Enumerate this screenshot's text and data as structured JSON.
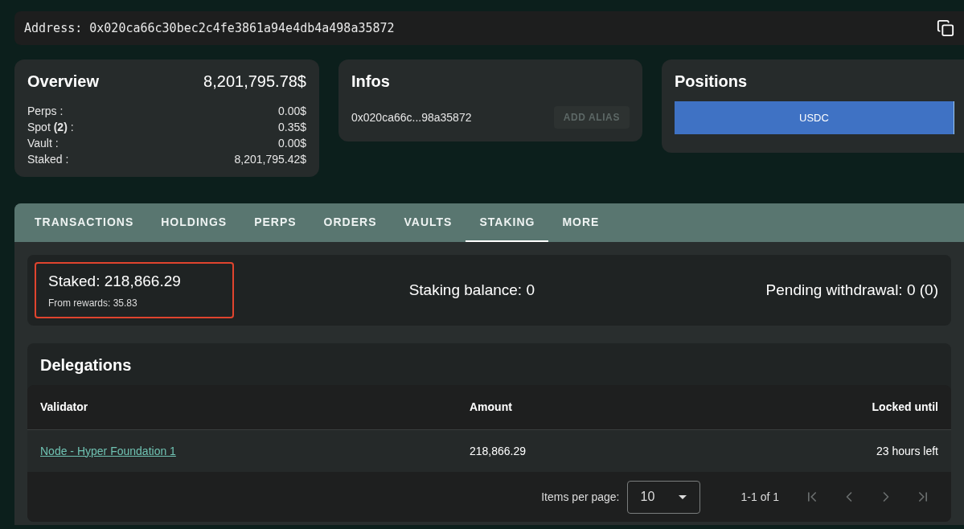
{
  "address": {
    "label": "Address: 0x020ca66c30bec2c4fe3861a94e4db4a498a35872"
  },
  "overview": {
    "title": "Overview",
    "total": "8,201,795.78$",
    "rows": [
      {
        "label": "Perps :",
        "value": "0.00$"
      },
      {
        "label": "Spot **(2)** :",
        "value": "0.35$"
      },
      {
        "label": "Vault :",
        "value": "0.00$"
      },
      {
        "label": "Staked :",
        "value": "8,201,795.42$"
      }
    ]
  },
  "infos": {
    "title": "Infos",
    "address": "0x020ca66c...98a35872",
    "button": {
      "label": "ADD ALIAS",
      "disabled": true
    }
  },
  "positions": {
    "title": "Positions",
    "segment": {
      "label": "USDC",
      "level": 0.997
    }
  },
  "tabs": [
    {
      "label": "TRANSACTIONS",
      "selected": false
    },
    {
      "label": "HOLDINGS",
      "selected": false
    },
    {
      "label": "PERPS",
      "selected": false
    },
    {
      "label": "ORDERS",
      "selected": false
    },
    {
      "label": "VAULTS",
      "selected": false
    },
    {
      "label": "STAKING",
      "selected": true
    },
    {
      "label": "MORE",
      "selected": false
    }
  ],
  "staking": {
    "staked": "Staked: 218,866.29",
    "rewards": "From rewards: 35.83",
    "highlighted": true,
    "balance": "Staking balance: 0",
    "pending": "Pending withdrawal: 0 (0)"
  },
  "delegations": {
    "title": "Delegations",
    "columns": [
      "Validator",
      "Amount",
      "Locked until"
    ],
    "rows": [
      {
        "validator": "Node - Hyper Foundation 1",
        "amount": "218,866.29",
        "locked": "23 hours left"
      }
    ],
    "pagination": {
      "items_label": "Items per page:",
      "per_page": "10",
      "range": "1-1 of 1",
      "buttons": [
        {
          "kind": "first",
          "disabled": true
        },
        {
          "kind": "prev",
          "disabled": true
        },
        {
          "kind": "next",
          "disabled": true
        },
        {
          "kind": "last",
          "disabled": true
        }
      ]
    }
  }
}
